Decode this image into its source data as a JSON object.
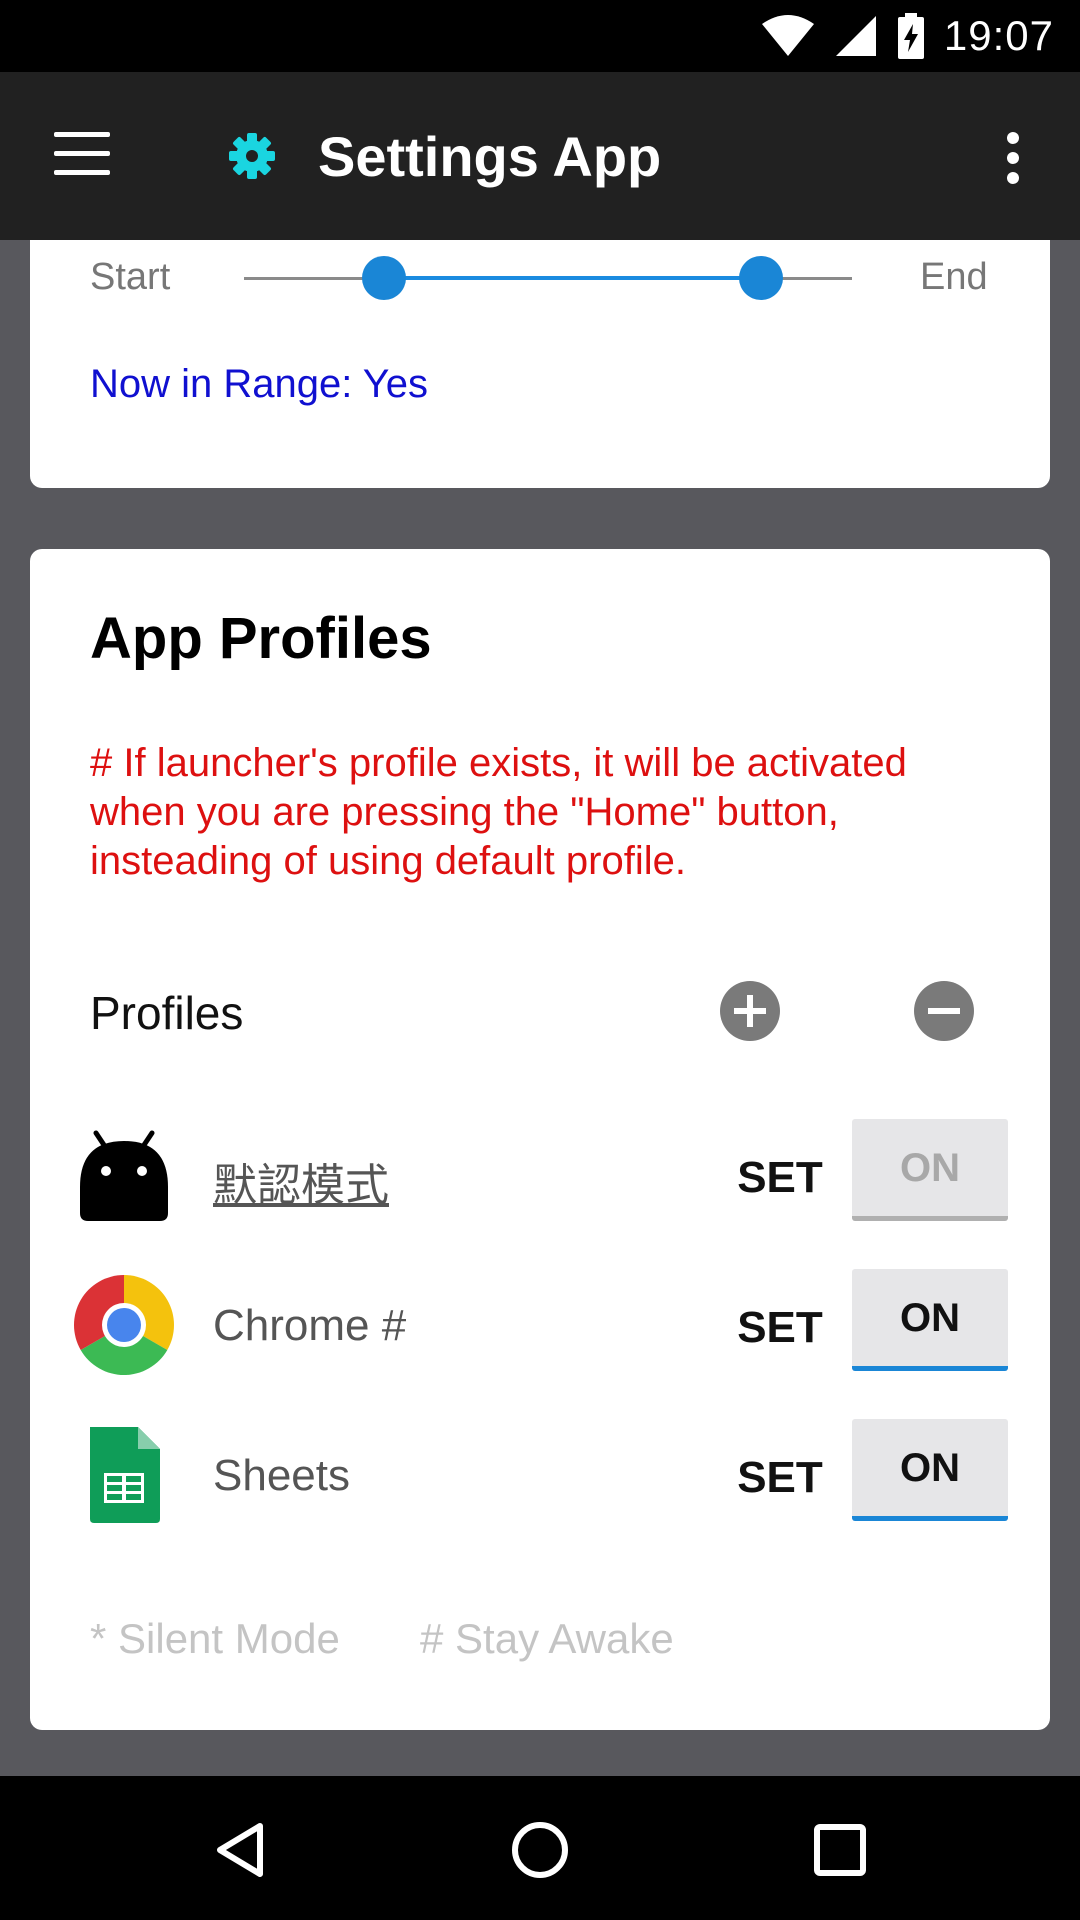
{
  "status_bar": {
    "time": "19:07",
    "icons": [
      "wifi-icon",
      "signal-icon",
      "battery-charging-icon"
    ]
  },
  "app_bar": {
    "title": "Settings App",
    "menu_icon": "hamburger-menu-icon",
    "app_icon": "gear-icon",
    "overflow_icon": "more-vert-icon",
    "accent_color": "#1ad5e0"
  },
  "time_range": {
    "start_label": "Start",
    "end_label": "End",
    "range_status": "Now in Range: Yes",
    "slider_start_fraction": 0.23,
    "slider_end_fraction": 0.85
  },
  "app_profiles": {
    "title": "App Profiles",
    "note_lines": [
      "# If launcher's profile exists, it will be activated",
      "when you are pressing the \"Home\" button,",
      "insteading of using default profile."
    ],
    "profiles_label": "Profiles",
    "add_icon": "add-circle-icon",
    "remove_icon": "remove-circle-icon",
    "rows": [
      {
        "name": "默認模式",
        "icon": "android-icon",
        "set_label": "SET",
        "toggle_label": "ON",
        "toggle_enabled": false
      },
      {
        "name": "Chrome #",
        "icon": "chrome-icon",
        "set_label": "SET",
        "toggle_label": "ON",
        "toggle_enabled": true
      },
      {
        "name": "Sheets",
        "icon": "sheets-icon",
        "set_label": "SET",
        "toggle_label": "ON",
        "toggle_enabled": true
      }
    ],
    "legend": {
      "silent": "* Silent Mode",
      "awake": "# Stay Awake"
    }
  },
  "nav_bar": {
    "icons": [
      "back-icon",
      "home-icon",
      "recents-icon"
    ]
  }
}
